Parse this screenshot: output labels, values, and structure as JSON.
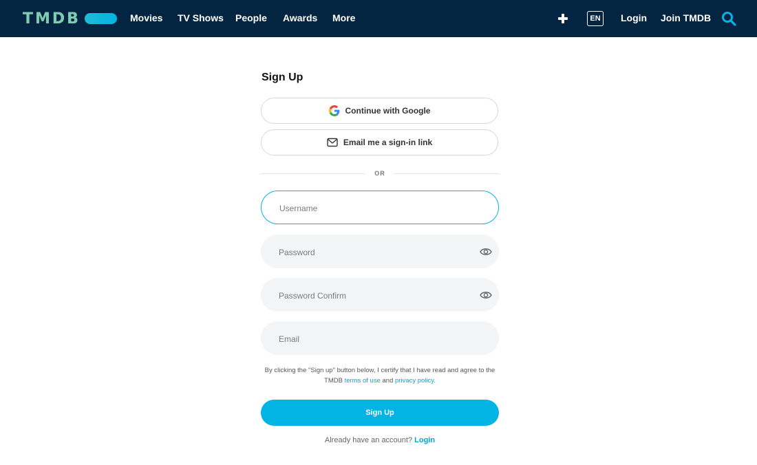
{
  "header": {
    "logo_text": "TMDB",
    "nav": [
      "Movies",
      "TV Shows",
      "People",
      "Awards",
      "More"
    ],
    "lang": "EN",
    "login": "Login",
    "join": "Join TMDB",
    "icons": {
      "add": "plus-icon",
      "search": "search-icon"
    },
    "colors": {
      "background": "#032541",
      "accent": "#01b4e4"
    }
  },
  "form": {
    "title": "Sign Up",
    "google_label": "Continue with Google",
    "email_link_label": "Email me a sign-in link",
    "divider": "OR",
    "username_placeholder": "Username",
    "password_placeholder": "Password",
    "password_confirm_placeholder": "Password Confirm",
    "email_placeholder": "Email",
    "legal_prefix": "By clicking the \"Sign up\" button below, I certify that I have read and agree to the TMDB",
    "terms_link": "terms of use",
    "legal_and": "and",
    "privacy_link": "privacy policy",
    "legal_end": ".",
    "submit_label": "Sign Up",
    "footer_prefix": "Already have an account?",
    "footer_link": "Login"
  }
}
